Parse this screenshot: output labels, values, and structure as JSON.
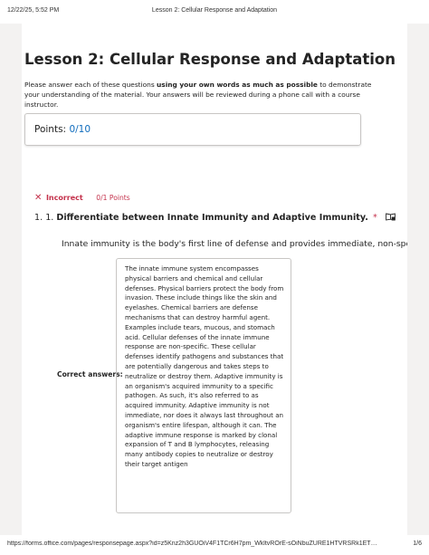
{
  "print_header": {
    "timestamp": "12/22/25, 5:52 PM",
    "doc_title": "Lesson 2: Cellular Response and Adaptation"
  },
  "print_footer": {
    "url": "https://forms.office.com/pages/responsepage.aspx?id=z5Knz2h3GUOiV4F1TCr6H7pm_WkltvROrE-sOiNbuZURE1HTVRSRk1ETUo4Vk9BOENUWUx...",
    "page": "1/6"
  },
  "form": {
    "title": "Lesson 2: Cellular Response and Adaptation",
    "intro_before": "Please answer each of these questions ",
    "intro_bold": "using your own words as much as possible",
    "intro_after": " to demonstrate your understanding of the material.  Your answers will be reviewed during a phone call with a course instructor.",
    "points_label": "Points:",
    "points_value": "0/10"
  },
  "question1": {
    "status": "Incorrect",
    "points": "0/1 Points",
    "number": "1. 1.",
    "text": "Differentiate between Innate Immunity and Adaptive Immunity.",
    "required_marker": "*",
    "response": "Innate immunity is the body's first line of defense and provides immediate, non-spec",
    "correct_answers_label": "Correct answers:",
    "correct_answer": "The innate immune system encompasses physical barriers and chemical and cellular defenses. Physical barriers protect the body from invasion. These include things like the skin and eyelashes. Chemical barriers are defense mechanisms that can destroy harmful agent. Examples include tears, mucous, and stomach acid. Cellular defenses of the innate immune response are non-specific. These cellular defenses identify pathogens and substances that are potentially dangerous and takes steps to neutralize or destroy them. Adaptive immunity is an organism's acquired immunity to a specific pathogen. As such, it's also referred to as acquired immunity. Adaptive immunity is not immediate, nor does it always last throughout an organism's entire lifespan, although it can. The adaptive immune response is marked by clonal expansion of T and B lymphocytes, releasing many antibody copies to neutralize or destroy their target antigen"
  },
  "colors": {
    "accent": "#0f6cbd",
    "error": "#c4314b",
    "background": "#f3f2f1"
  },
  "icons": {
    "status": "x-icon",
    "reader": "immersive-reader-icon"
  }
}
